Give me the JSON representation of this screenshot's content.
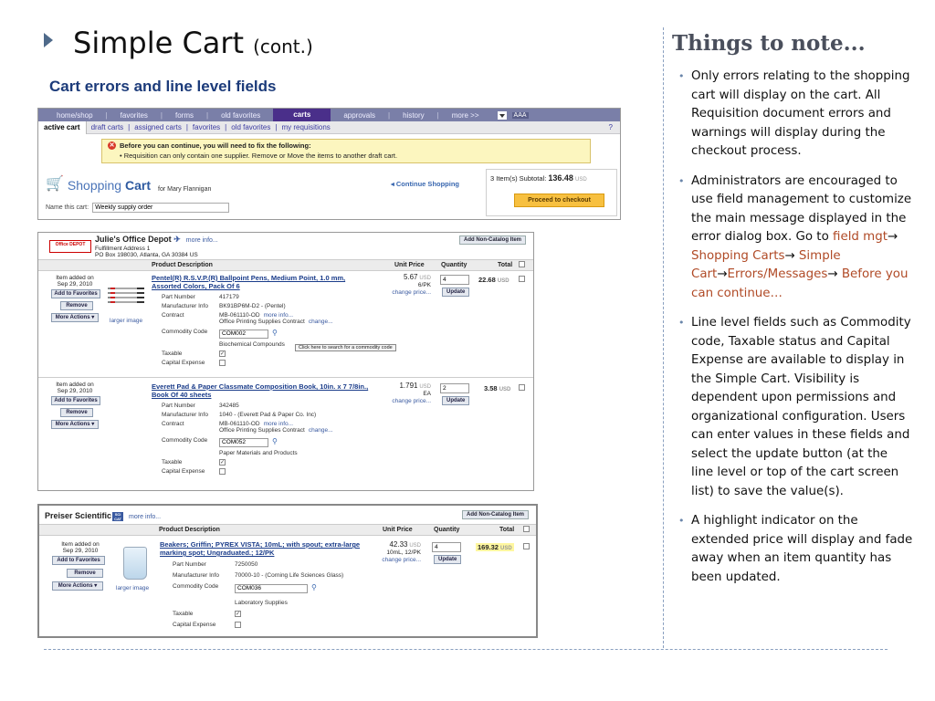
{
  "slide": {
    "title": "Simple Cart",
    "title_suffix": "(cont.)",
    "subtitle": "Cart errors and line level fields"
  },
  "notes": {
    "heading": "Things to note...",
    "bullet1": "Only errors relating to the shopping cart will display on the cart.  All Requisition document errors and warnings will display during the checkout process.",
    "bullet2_a": "Administrators are encouraged to use field management to customize the main message displayed in the error dialog box.  Go to ",
    "bullet2_p1": "field mgt",
    "bullet2_p2": " Shopping Carts",
    "bullet2_p3": " Simple Cart",
    "bullet2_p4": "Errors/Messages",
    "bullet2_p5": " Before you can continue…",
    "arrow": "→",
    "bullet3": "Line level fields such as Commodity code, Taxable status and Capital Expense are available to display in the Simple Cart. Visibility is dependent upon permissions and organizational configuration.  Users can enter values in these fields and select the update button (at the line level or top of the cart screen list) to save the value(s).",
    "bullet4": "A highlight indicator on the extended price will display and fade away when an item quantity has been updated.",
    "link_color": "#b04a26"
  },
  "nav": {
    "tabs": [
      "home/shop",
      "favorites",
      "forms",
      "old favorites",
      "carts",
      "approvals",
      "history",
      "more >>"
    ],
    "active_tab": "carts",
    "text_size": "AAA",
    "subtabs": [
      "active cart",
      "draft carts",
      "assigned carts",
      "favorites",
      "old favorites",
      "my requisitions"
    ],
    "help": "?"
  },
  "error_box": {
    "heading": "Before you can continue, you will need to fix the following:",
    "detail": "Requisition can only contain one supplier. Remove or Move the items to another draft cart."
  },
  "cart_header": {
    "title_a": "Shopping",
    "title_b": "Cart",
    "for_user": "for Mary Flannigan",
    "name_label": "Name this cart:",
    "name_value": "Weekly supply order",
    "continue_shopping": "Continue Shopping",
    "subtotal_label": "3 Item(s) Subtotal:",
    "subtotal_value": "136.48",
    "currency": "USD",
    "proceed": "Proceed to checkout"
  },
  "columns": {
    "product": "Product Description",
    "unit_price": "Unit Price",
    "quantity": "Quantity",
    "total": "Total"
  },
  "labels": {
    "item_added_on": "Item added on",
    "add_to_favorites": "Add to Favorites",
    "remove": "Remove",
    "more_actions": "More Actions",
    "larger_image": "larger image",
    "part_number": "Part Number",
    "manufacturer_info": "Manufacturer Info",
    "contract": "Contract",
    "commodity_code": "Commodity Code",
    "taxable": "Taxable",
    "capital_expense": "Capital Expense",
    "more_info": "more info...",
    "change": "change...",
    "change_price": "change price...",
    "update": "Update",
    "add_non_catalog": "Add Non-Catalog Item",
    "commodity_tip": "Click here to search for a commodity code"
  },
  "supplier1": {
    "name": "Julie's Office Depot",
    "logo_text": "Office DEPOT",
    "address1": "Fulfillment Address 1",
    "address2": "PO Box 198030, Atlanta, GA 30384 US",
    "lines": [
      {
        "date": "Sep 29, 2010",
        "desc": "Pentel(R) R.S.V.P.(R) Ballpoint Pens, Medium Point, 1.0 mm, Assorted Colors, Pack Of 6",
        "part_number": "417179",
        "manufacturer": "BK91BP6M-D2 - (Pentel)",
        "contract_id": "MB-061110-OD",
        "contract_name": "Office Printing Supplies Contract",
        "commodity_code": "COM002",
        "commodity_name": "Biochemical Compounds",
        "price": "5.67",
        "uom": "6/PK",
        "qty": "4",
        "total": "22.68",
        "taxable": true,
        "capital": false
      },
      {
        "date": "Sep 29, 2010",
        "desc": "Everett Pad & Paper Classmate Composition Book, 10in. x 7 7/8in., Book Of 40 sheets",
        "part_number": "342485",
        "manufacturer": "1040 - (Everett Pad & Paper Co. Inc)",
        "contract_id": "MB-061110-OD",
        "contract_name": "Office Printing Supplies Contract",
        "commodity_code": "COM052",
        "commodity_name": "Paper Materials and Products",
        "price": "1.791",
        "uom": "EA",
        "qty": "2",
        "total": "3.58",
        "taxable": true,
        "capital": false
      }
    ]
  },
  "supplier2": {
    "name": "Preiser Scientific",
    "logo_badge": "SCI CAT",
    "lines": [
      {
        "date": "Sep 29, 2010",
        "desc": "Beakers; Griffin; PYREX VISTA; 10mL; with spout; extra-large marking spot; Ungraduated.; 12/PK",
        "part_number": "7250050",
        "manufacturer": "70000-10 - (Corning Life Sciences Glass)",
        "commodity_code": "COM036",
        "commodity_name": "Laboratory Supplies",
        "price": "42.33",
        "uom": "10mL, 12/PK",
        "qty": "4",
        "total": "169.32",
        "taxable": true,
        "capital": false
      }
    ]
  },
  "colors": {
    "nav_bg": "#7a7fa8",
    "nav_active": "#4a2f8a",
    "error_bg": "#fcf6bf",
    "link": "#1a3c8a",
    "highlight": "#fff7a0",
    "proceed_bg": "#f7c040"
  }
}
